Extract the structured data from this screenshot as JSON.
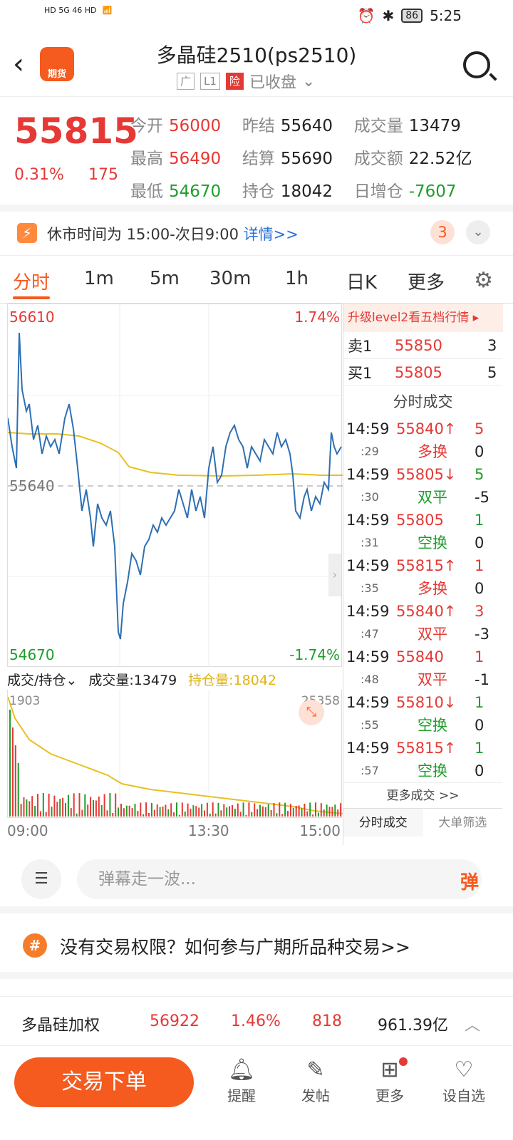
{
  "status": {
    "left_text": "HD 5G 46 HD",
    "battery": "86",
    "time": "5:25"
  },
  "header": {
    "logo_label": "期货",
    "title": "多晶硅2510(ps2510)",
    "tag1": "广",
    "tag2": "L1",
    "tag3": "险",
    "status_label": "已收盘"
  },
  "quote": {
    "price": "55815",
    "pct": "0.31%",
    "change": "175",
    "rows": [
      [
        {
          "k": "今开",
          "v": "56000",
          "c": "red"
        },
        {
          "k": "昨结",
          "v": "55640",
          "c": "dark"
        },
        {
          "k": "成交量",
          "v": "13479",
          "c": "dark"
        }
      ],
      [
        {
          "k": "最高",
          "v": "56490",
          "c": "red"
        },
        {
          "k": "结算",
          "v": "55690",
          "c": "dark"
        },
        {
          "k": "成交额",
          "v": "22.52亿",
          "c": "dark"
        }
      ],
      [
        {
          "k": "最低",
          "v": "54670",
          "c": "green"
        },
        {
          "k": "持仓",
          "v": "18042",
          "c": "dark"
        },
        {
          "k": "日增仓",
          "v": "-7607",
          "c": "green"
        }
      ]
    ]
  },
  "notice": {
    "text": "休市时间为 15:00-次日9:00",
    "link": "详情>>",
    "count": "3"
  },
  "tabs": [
    "分时",
    "1m",
    "5m",
    "30m",
    "1h",
    "日K",
    "更多"
  ],
  "chart": {
    "top_price": "56610",
    "top_pct": "1.74%",
    "mid_price": "55640",
    "bottom_price": "54670",
    "bottom_pct": "-1.74%",
    "volume_selector": "成交/持仓",
    "volume_label": "成交量:13479",
    "position_label": "持仓量:18042",
    "vol_max": "1903",
    "pos_max": "25358",
    "time_start": "09:00",
    "time_mid": "13:30",
    "time_end": "15:00"
  },
  "side": {
    "upgrade": "升级level2看五档行情 ▸",
    "book": [
      {
        "label": "卖1",
        "price": "55850",
        "qty": "3"
      },
      {
        "label": "买1",
        "price": "55805",
        "qty": "5"
      }
    ],
    "trade_header": "分时成交",
    "trades": [
      {
        "time": "14:59",
        "sec": ":29",
        "price": "55840↑",
        "pc": "red",
        "type": "多换",
        "tc": "red",
        "q1": "5",
        "q1c": "red",
        "q2": "0"
      },
      {
        "time": "14:59",
        "sec": ":30",
        "price": "55805↓",
        "pc": "red",
        "type": "双平",
        "tc": "green",
        "q1": "5",
        "q1c": "green",
        "q2": "-5"
      },
      {
        "time": "14:59",
        "sec": ":31",
        "price": "55805",
        "pc": "red",
        "type": "空换",
        "tc": "green",
        "q1": "1",
        "q1c": "green",
        "q2": "0"
      },
      {
        "time": "14:59",
        "sec": ":35",
        "price": "55815↑",
        "pc": "red",
        "type": "多换",
        "tc": "red",
        "q1": "1",
        "q1c": "red",
        "q2": "0"
      },
      {
        "time": "14:59",
        "sec": ":47",
        "price": "55840↑",
        "pc": "red",
        "type": "双平",
        "tc": "red",
        "q1": "3",
        "q1c": "red",
        "q2": "-3"
      },
      {
        "time": "14:59",
        "sec": ":48",
        "price": "55840",
        "pc": "red",
        "type": "双平",
        "tc": "red",
        "q1": "1",
        "q1c": "red",
        "q2": "-1"
      },
      {
        "time": "14:59",
        "sec": ":55",
        "price": "55810↓",
        "pc": "red",
        "type": "空换",
        "tc": "green",
        "q1": "1",
        "q1c": "green",
        "q2": "0"
      },
      {
        "time": "14:59",
        "sec": ":57",
        "price": "55815↑",
        "pc": "red",
        "type": "空换",
        "tc": "green",
        "q1": "1",
        "q1c": "green",
        "q2": "0"
      }
    ],
    "more": "更多成交 >>",
    "tab1": "分时成交",
    "tab2": "大单筛选"
  },
  "comment": {
    "placeholder": "弹幕走一波...",
    "danmu": "弹"
  },
  "promo": "没有交易权限？如何参与广期所品种交易>>",
  "ticker": {
    "name": "多晶硅加权",
    "price": "56922",
    "pct": "1.46%",
    "change": "818",
    "amount": "961.39亿"
  },
  "nav": {
    "order": "交易下单",
    "remind": "提醒",
    "post": "发帖",
    "more": "更多",
    "watch": "设自选"
  },
  "colors": {
    "up": "#e53935",
    "down": "#1e9e2a",
    "accent": "#f55a1e",
    "line": "#2e6fb3",
    "avg": "#e8c021"
  }
}
